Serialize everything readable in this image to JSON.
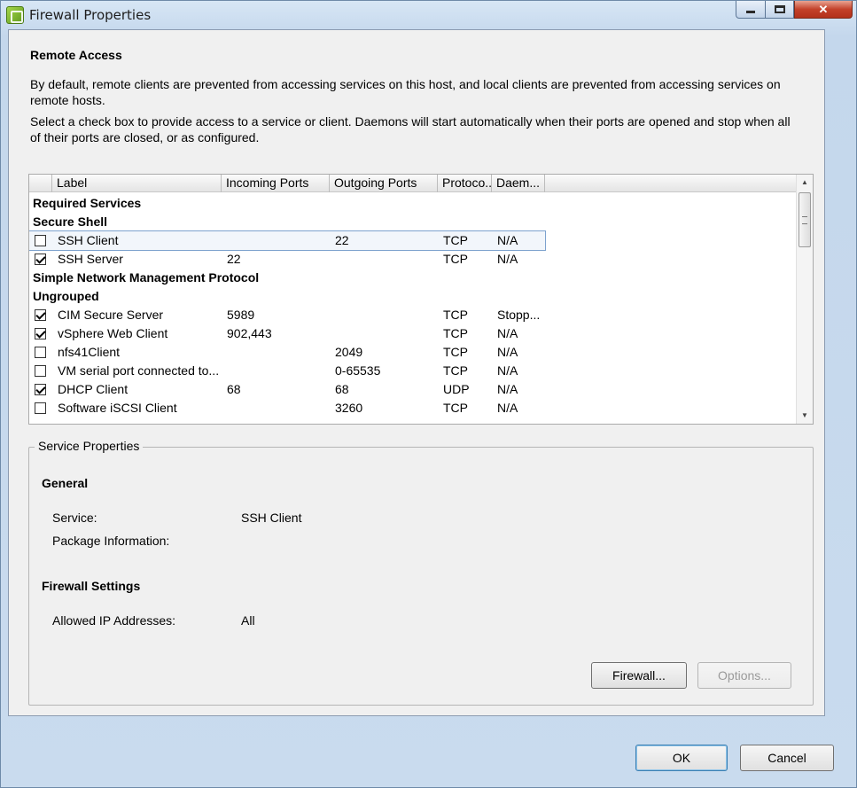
{
  "window": {
    "title": "Firewall Properties"
  },
  "section": {
    "heading": "Remote Access",
    "description1": "By default, remote clients are prevented from accessing services on this host, and local clients are prevented from accessing services on remote hosts.",
    "description2": "Select a check box to provide access to a service or client. Daemons will start automatically when their ports are opened and stop when all of their ports are closed, or as configured."
  },
  "table": {
    "columns": [
      "Label",
      "Incoming Ports",
      "Outgoing Ports",
      "Protoco...",
      "Daem..."
    ],
    "groups": [
      {
        "title": "Required Services",
        "rows": []
      },
      {
        "title": "Secure Shell",
        "rows": [
          {
            "checked": false,
            "selected": true,
            "label": "SSH Client",
            "incoming": "",
            "outgoing": "22",
            "protocol": "TCP",
            "daemon": "N/A"
          },
          {
            "checked": true,
            "selected": false,
            "label": "SSH Server",
            "incoming": "22",
            "outgoing": "",
            "protocol": "TCP",
            "daemon": "N/A"
          }
        ]
      },
      {
        "title": "Simple Network Management Protocol",
        "rows": []
      },
      {
        "title": "Ungrouped",
        "rows": [
          {
            "checked": true,
            "selected": false,
            "label": "CIM Secure Server",
            "incoming": "5989",
            "outgoing": "",
            "protocol": "TCP",
            "daemon": "Stopp..."
          },
          {
            "checked": true,
            "selected": false,
            "label": "vSphere Web Client",
            "incoming": "902,443",
            "outgoing": "",
            "protocol": "TCP",
            "daemon": "N/A"
          },
          {
            "checked": false,
            "selected": false,
            "label": "nfs41Client",
            "incoming": "",
            "outgoing": "2049",
            "protocol": "TCP",
            "daemon": "N/A"
          },
          {
            "checked": false,
            "selected": false,
            "label": "VM serial port connected to...",
            "incoming": "",
            "outgoing": "0-65535",
            "protocol": "TCP",
            "daemon": "N/A"
          },
          {
            "checked": true,
            "selected": false,
            "label": "DHCP Client",
            "incoming": "68",
            "outgoing": "68",
            "protocol": "UDP",
            "daemon": "N/A"
          },
          {
            "checked": false,
            "selected": false,
            "label": "Software iSCSI Client",
            "incoming": "",
            "outgoing": "3260",
            "protocol": "TCP",
            "daemon": "N/A"
          }
        ]
      }
    ]
  },
  "service_properties": {
    "legend": "Service Properties",
    "general_heading": "General",
    "service_label": "Service:",
    "service_value": "SSH Client",
    "package_label": "Package Information:",
    "package_value": "",
    "firewall_heading": "Firewall Settings",
    "allowed_ip_label": "Allowed IP Addresses:",
    "allowed_ip_value": "All",
    "firewall_button": "Firewall...",
    "options_button": "Options..."
  },
  "footer": {
    "ok": "OK",
    "cancel": "Cancel"
  }
}
